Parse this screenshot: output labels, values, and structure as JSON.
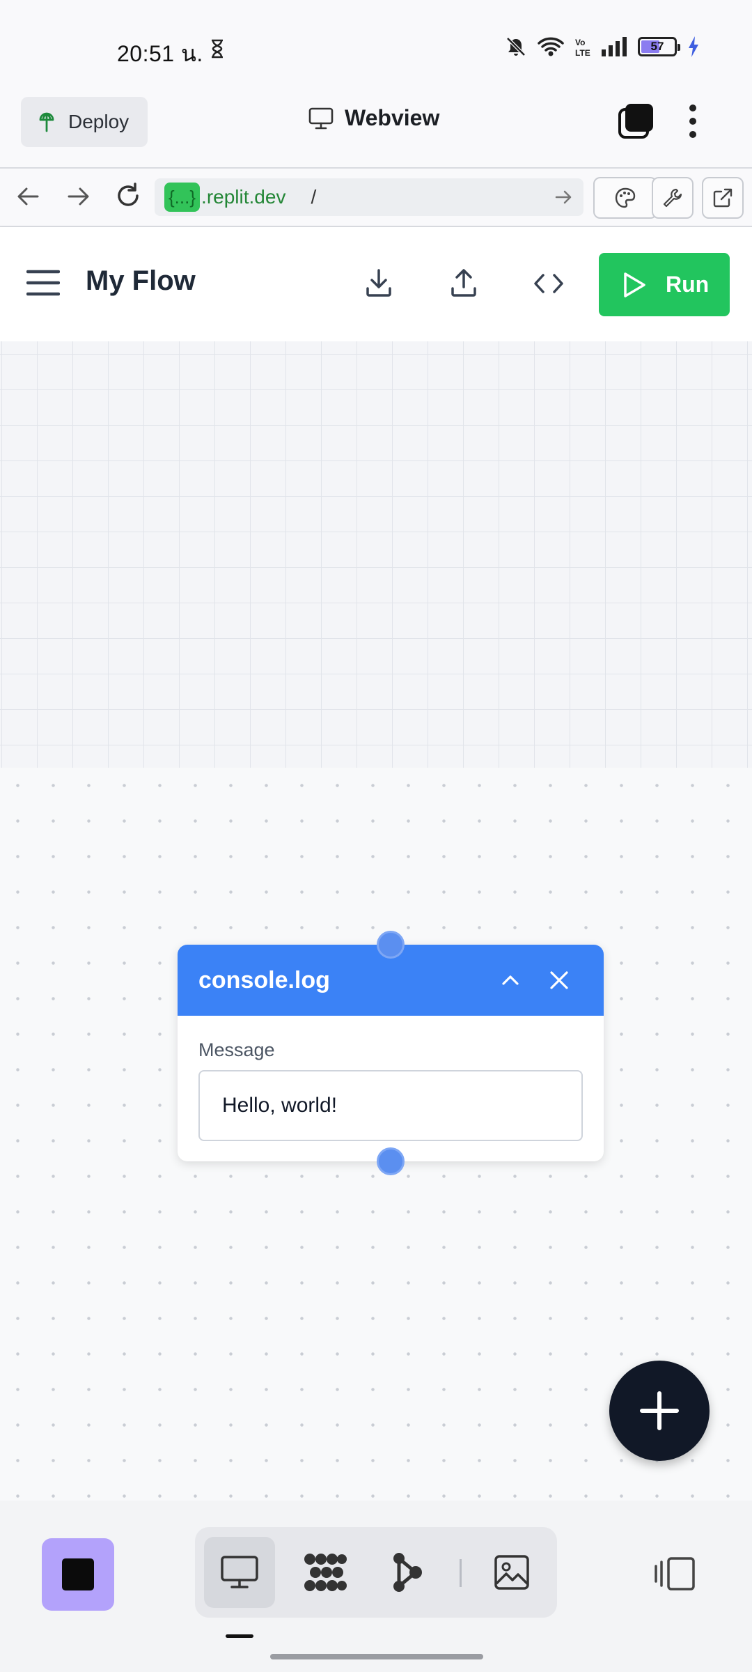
{
  "status_bar": {
    "time": "20:51 น.",
    "battery_level": "57",
    "battery_fraction": 0.57
  },
  "replit_bar": {
    "deploy_label": "Deploy",
    "view_title": "Webview"
  },
  "url_bar": {
    "chip": "{...}",
    "host": ".replit.dev",
    "path": "/"
  },
  "app_header": {
    "title": "My Flow",
    "run_label": "Run"
  },
  "node": {
    "title": "console.log",
    "field_label": "Message",
    "field_value": "Hello, world!"
  },
  "colors": {
    "accent_green": "#22c55e",
    "node_blue": "#3b82f6",
    "fab_dark": "#111827",
    "stop_purple": "#b3a2fb"
  },
  "icons": {
    "status": [
      "hourglass-icon",
      "mute-bell-icon",
      "wifi-icon",
      "volte-icon",
      "signal-icon",
      "battery-icon",
      "charging-icon"
    ],
    "replit_bar": [
      "deploy-icon",
      "monitor-icon",
      "tabs-icon",
      "kebab-menu-icon"
    ],
    "url_bar": [
      "back-arrow-icon",
      "forward-arrow-icon",
      "reload-icon",
      "go-arrow-icon",
      "palette-icon",
      "wrench-icon",
      "external-link-icon"
    ],
    "app_header": [
      "hamburger-menu-icon",
      "download-icon",
      "upload-icon",
      "code-icon",
      "play-icon"
    ],
    "node": [
      "chevron-up-icon",
      "close-icon"
    ],
    "bottom_bar": [
      "stop-icon",
      "monitor-icon",
      "grid-dots-icon",
      "graph-icon",
      "image-icon",
      "split-view-icon"
    ]
  }
}
